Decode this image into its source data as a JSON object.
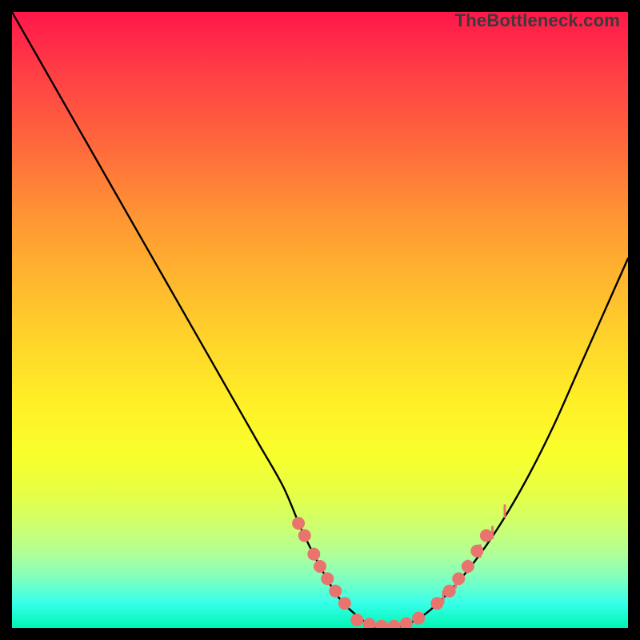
{
  "watermark": "TheBottleneck.com",
  "colors": {
    "curve": "#000000",
    "markers": "#e9746e",
    "bg_top": "#ff174a",
    "bg_bottom": "#00f6b3"
  },
  "chart_data": {
    "type": "line",
    "title": "",
    "xlabel": "",
    "ylabel": "",
    "xlim": [
      0,
      100
    ],
    "ylim": [
      0,
      100
    ],
    "grid": false,
    "series": [
      {
        "name": "bottleneck-curve",
        "x": [
          0,
          4,
          8,
          12,
          16,
          20,
          24,
          28,
          32,
          36,
          40,
          44,
          47,
          50,
          53,
          56,
          59,
          62,
          65,
          68,
          72,
          76,
          80,
          84,
          88,
          92,
          96,
          100
        ],
        "y": [
          100,
          93,
          86,
          79,
          72,
          65,
          58,
          51,
          44,
          37,
          30,
          23,
          16,
          10,
          5,
          2,
          0,
          0,
          1,
          3,
          7,
          12,
          18,
          25,
          33,
          42,
          51,
          60
        ]
      }
    ],
    "markers": [
      {
        "name": "left-cluster",
        "style": "circle",
        "r": 8,
        "x": [
          46.5,
          47.5,
          49.0,
          50.0,
          51.2,
          52.5,
          54.0
        ],
        "y": [
          17.0,
          15.0,
          12.0,
          10.0,
          8.0,
          6.0,
          4.0
        ]
      },
      {
        "name": "flat-cluster",
        "style": "circle",
        "r": 8,
        "x": [
          56.0,
          58.0,
          60.0,
          62.0,
          64.0,
          66.0
        ],
        "y": [
          1.3,
          0.6,
          0.3,
          0.3,
          0.7,
          1.6
        ]
      },
      {
        "name": "right-cluster",
        "style": "circle",
        "r": 8,
        "x": [
          69.0,
          71.0,
          72.5,
          74.0,
          75.5,
          77.0
        ],
        "y": [
          4.0,
          6.0,
          8.0,
          10.0,
          12.5,
          15.0
        ]
      },
      {
        "name": "right-ticks",
        "style": "tick",
        "h": 14,
        "x": [
          70.0,
          72.0,
          74.0,
          76.0,
          78.0,
          80.0
        ],
        "y": [
          5.0,
          7.5,
          10.0,
          12.5,
          15.5,
          19.0
        ]
      }
    ]
  }
}
